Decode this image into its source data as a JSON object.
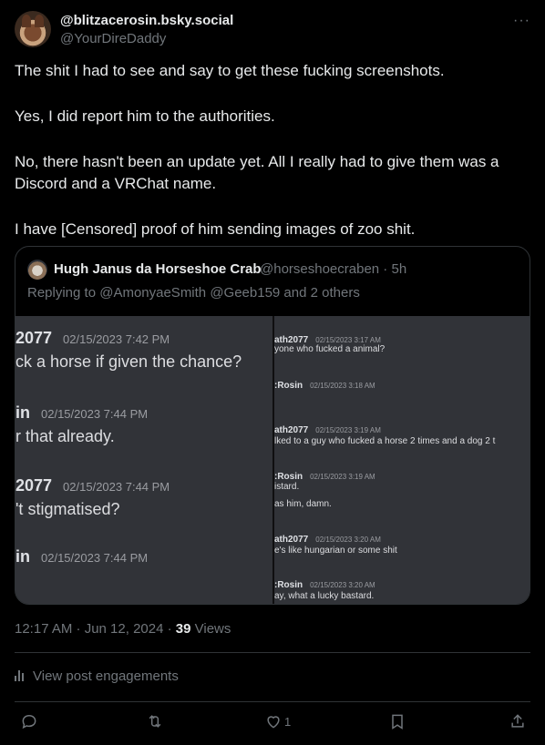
{
  "author": {
    "display_name": "@blitzacerosin.bsky.social",
    "handle": "@YourDireDaddy"
  },
  "post": {
    "paragraphs": [
      "The shit I had to see and say to get these fucking screenshots.",
      "Yes, I did report him to the authorities.",
      "No, there hasn't been an update yet. All I really had to give them was a Discord and a VRChat name.",
      "I have [Censored] proof of him sending images of zoo shit."
    ],
    "timestamp": "12:17 AM · Jun 12, 2024 · ",
    "views_count": "39",
    "views_label": " Views"
  },
  "quoted": {
    "display_name": "Hugh Janus da Horseshoe Crab",
    "meta": "@horseshoecraben · 5h",
    "replying_to": "Replying to @AmonyaeSmith @Geeb159 and 2 others",
    "left_messages": [
      {
        "user": "2077",
        "time": "02/15/2023 7:42 PM",
        "text": "ck a horse if given the chance?"
      },
      {
        "user": "in",
        "time": "02/15/2023 7:44 PM",
        "text": "r that already."
      },
      {
        "user": "2077",
        "time": "02/15/2023 7:44 PM",
        "text": "'t stigmatised?"
      },
      {
        "user": "in",
        "time": "02/15/2023 7:44 PM",
        "text": ""
      }
    ],
    "right_messages": [
      {
        "user": "ath2077",
        "time": "02/15/2023 3:17 AM",
        "text": "yone who fucked a animal?"
      },
      {
        "user": ":Rosin",
        "time": "02/15/2023 3:18 AM",
        "text": ""
      },
      {
        "user": "ath2077",
        "time": "02/15/2023 3:19 AM",
        "text": "lked to a guy who fucked a horse 2 times and a dog 2 t"
      },
      {
        "user": ":Rosin",
        "time": "02/15/2023 3:19 AM",
        "text": "istard."
      },
      {
        "user": "",
        "time": "",
        "text": "as him, damn."
      },
      {
        "user": "ath2077",
        "time": "02/15/2023 3:20 AM",
        "text": "e's like hungarian or some shit"
      },
      {
        "user": ":Rosin",
        "time": "02/15/2023 3:20 AM",
        "text": "ay, what a lucky bastard."
      }
    ]
  },
  "engagements_label": "View post engagements",
  "actions": {
    "like_count": "1"
  },
  "more_glyph": "···"
}
